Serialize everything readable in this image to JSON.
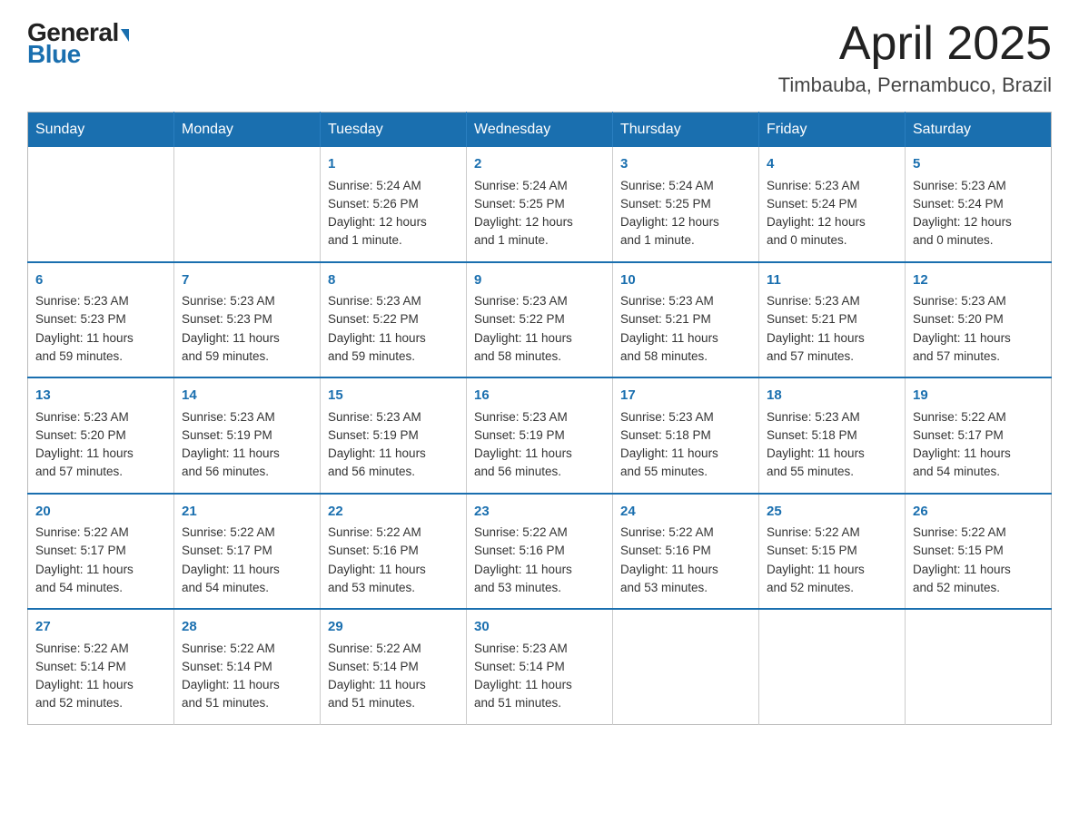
{
  "header": {
    "logo_general": "General",
    "logo_blue": "Blue",
    "month_title": "April 2025",
    "location": "Timbauba, Pernambuco, Brazil"
  },
  "days_of_week": [
    "Sunday",
    "Monday",
    "Tuesday",
    "Wednesday",
    "Thursday",
    "Friday",
    "Saturday"
  ],
  "weeks": [
    [
      {
        "day": "",
        "info": ""
      },
      {
        "day": "",
        "info": ""
      },
      {
        "day": "1",
        "info": "Sunrise: 5:24 AM\nSunset: 5:26 PM\nDaylight: 12 hours\nand 1 minute."
      },
      {
        "day": "2",
        "info": "Sunrise: 5:24 AM\nSunset: 5:25 PM\nDaylight: 12 hours\nand 1 minute."
      },
      {
        "day": "3",
        "info": "Sunrise: 5:24 AM\nSunset: 5:25 PM\nDaylight: 12 hours\nand 1 minute."
      },
      {
        "day": "4",
        "info": "Sunrise: 5:23 AM\nSunset: 5:24 PM\nDaylight: 12 hours\nand 0 minutes."
      },
      {
        "day": "5",
        "info": "Sunrise: 5:23 AM\nSunset: 5:24 PM\nDaylight: 12 hours\nand 0 minutes."
      }
    ],
    [
      {
        "day": "6",
        "info": "Sunrise: 5:23 AM\nSunset: 5:23 PM\nDaylight: 11 hours\nand 59 minutes."
      },
      {
        "day": "7",
        "info": "Sunrise: 5:23 AM\nSunset: 5:23 PM\nDaylight: 11 hours\nand 59 minutes."
      },
      {
        "day": "8",
        "info": "Sunrise: 5:23 AM\nSunset: 5:22 PM\nDaylight: 11 hours\nand 59 minutes."
      },
      {
        "day": "9",
        "info": "Sunrise: 5:23 AM\nSunset: 5:22 PM\nDaylight: 11 hours\nand 58 minutes."
      },
      {
        "day": "10",
        "info": "Sunrise: 5:23 AM\nSunset: 5:21 PM\nDaylight: 11 hours\nand 58 minutes."
      },
      {
        "day": "11",
        "info": "Sunrise: 5:23 AM\nSunset: 5:21 PM\nDaylight: 11 hours\nand 57 minutes."
      },
      {
        "day": "12",
        "info": "Sunrise: 5:23 AM\nSunset: 5:20 PM\nDaylight: 11 hours\nand 57 minutes."
      }
    ],
    [
      {
        "day": "13",
        "info": "Sunrise: 5:23 AM\nSunset: 5:20 PM\nDaylight: 11 hours\nand 57 minutes."
      },
      {
        "day": "14",
        "info": "Sunrise: 5:23 AM\nSunset: 5:19 PM\nDaylight: 11 hours\nand 56 minutes."
      },
      {
        "day": "15",
        "info": "Sunrise: 5:23 AM\nSunset: 5:19 PM\nDaylight: 11 hours\nand 56 minutes."
      },
      {
        "day": "16",
        "info": "Sunrise: 5:23 AM\nSunset: 5:19 PM\nDaylight: 11 hours\nand 56 minutes."
      },
      {
        "day": "17",
        "info": "Sunrise: 5:23 AM\nSunset: 5:18 PM\nDaylight: 11 hours\nand 55 minutes."
      },
      {
        "day": "18",
        "info": "Sunrise: 5:23 AM\nSunset: 5:18 PM\nDaylight: 11 hours\nand 55 minutes."
      },
      {
        "day": "19",
        "info": "Sunrise: 5:22 AM\nSunset: 5:17 PM\nDaylight: 11 hours\nand 54 minutes."
      }
    ],
    [
      {
        "day": "20",
        "info": "Sunrise: 5:22 AM\nSunset: 5:17 PM\nDaylight: 11 hours\nand 54 minutes."
      },
      {
        "day": "21",
        "info": "Sunrise: 5:22 AM\nSunset: 5:17 PM\nDaylight: 11 hours\nand 54 minutes."
      },
      {
        "day": "22",
        "info": "Sunrise: 5:22 AM\nSunset: 5:16 PM\nDaylight: 11 hours\nand 53 minutes."
      },
      {
        "day": "23",
        "info": "Sunrise: 5:22 AM\nSunset: 5:16 PM\nDaylight: 11 hours\nand 53 minutes."
      },
      {
        "day": "24",
        "info": "Sunrise: 5:22 AM\nSunset: 5:16 PM\nDaylight: 11 hours\nand 53 minutes."
      },
      {
        "day": "25",
        "info": "Sunrise: 5:22 AM\nSunset: 5:15 PM\nDaylight: 11 hours\nand 52 minutes."
      },
      {
        "day": "26",
        "info": "Sunrise: 5:22 AM\nSunset: 5:15 PM\nDaylight: 11 hours\nand 52 minutes."
      }
    ],
    [
      {
        "day": "27",
        "info": "Sunrise: 5:22 AM\nSunset: 5:14 PM\nDaylight: 11 hours\nand 52 minutes."
      },
      {
        "day": "28",
        "info": "Sunrise: 5:22 AM\nSunset: 5:14 PM\nDaylight: 11 hours\nand 51 minutes."
      },
      {
        "day": "29",
        "info": "Sunrise: 5:22 AM\nSunset: 5:14 PM\nDaylight: 11 hours\nand 51 minutes."
      },
      {
        "day": "30",
        "info": "Sunrise: 5:23 AM\nSunset: 5:14 PM\nDaylight: 11 hours\nand 51 minutes."
      },
      {
        "day": "",
        "info": ""
      },
      {
        "day": "",
        "info": ""
      },
      {
        "day": "",
        "info": ""
      }
    ]
  ]
}
